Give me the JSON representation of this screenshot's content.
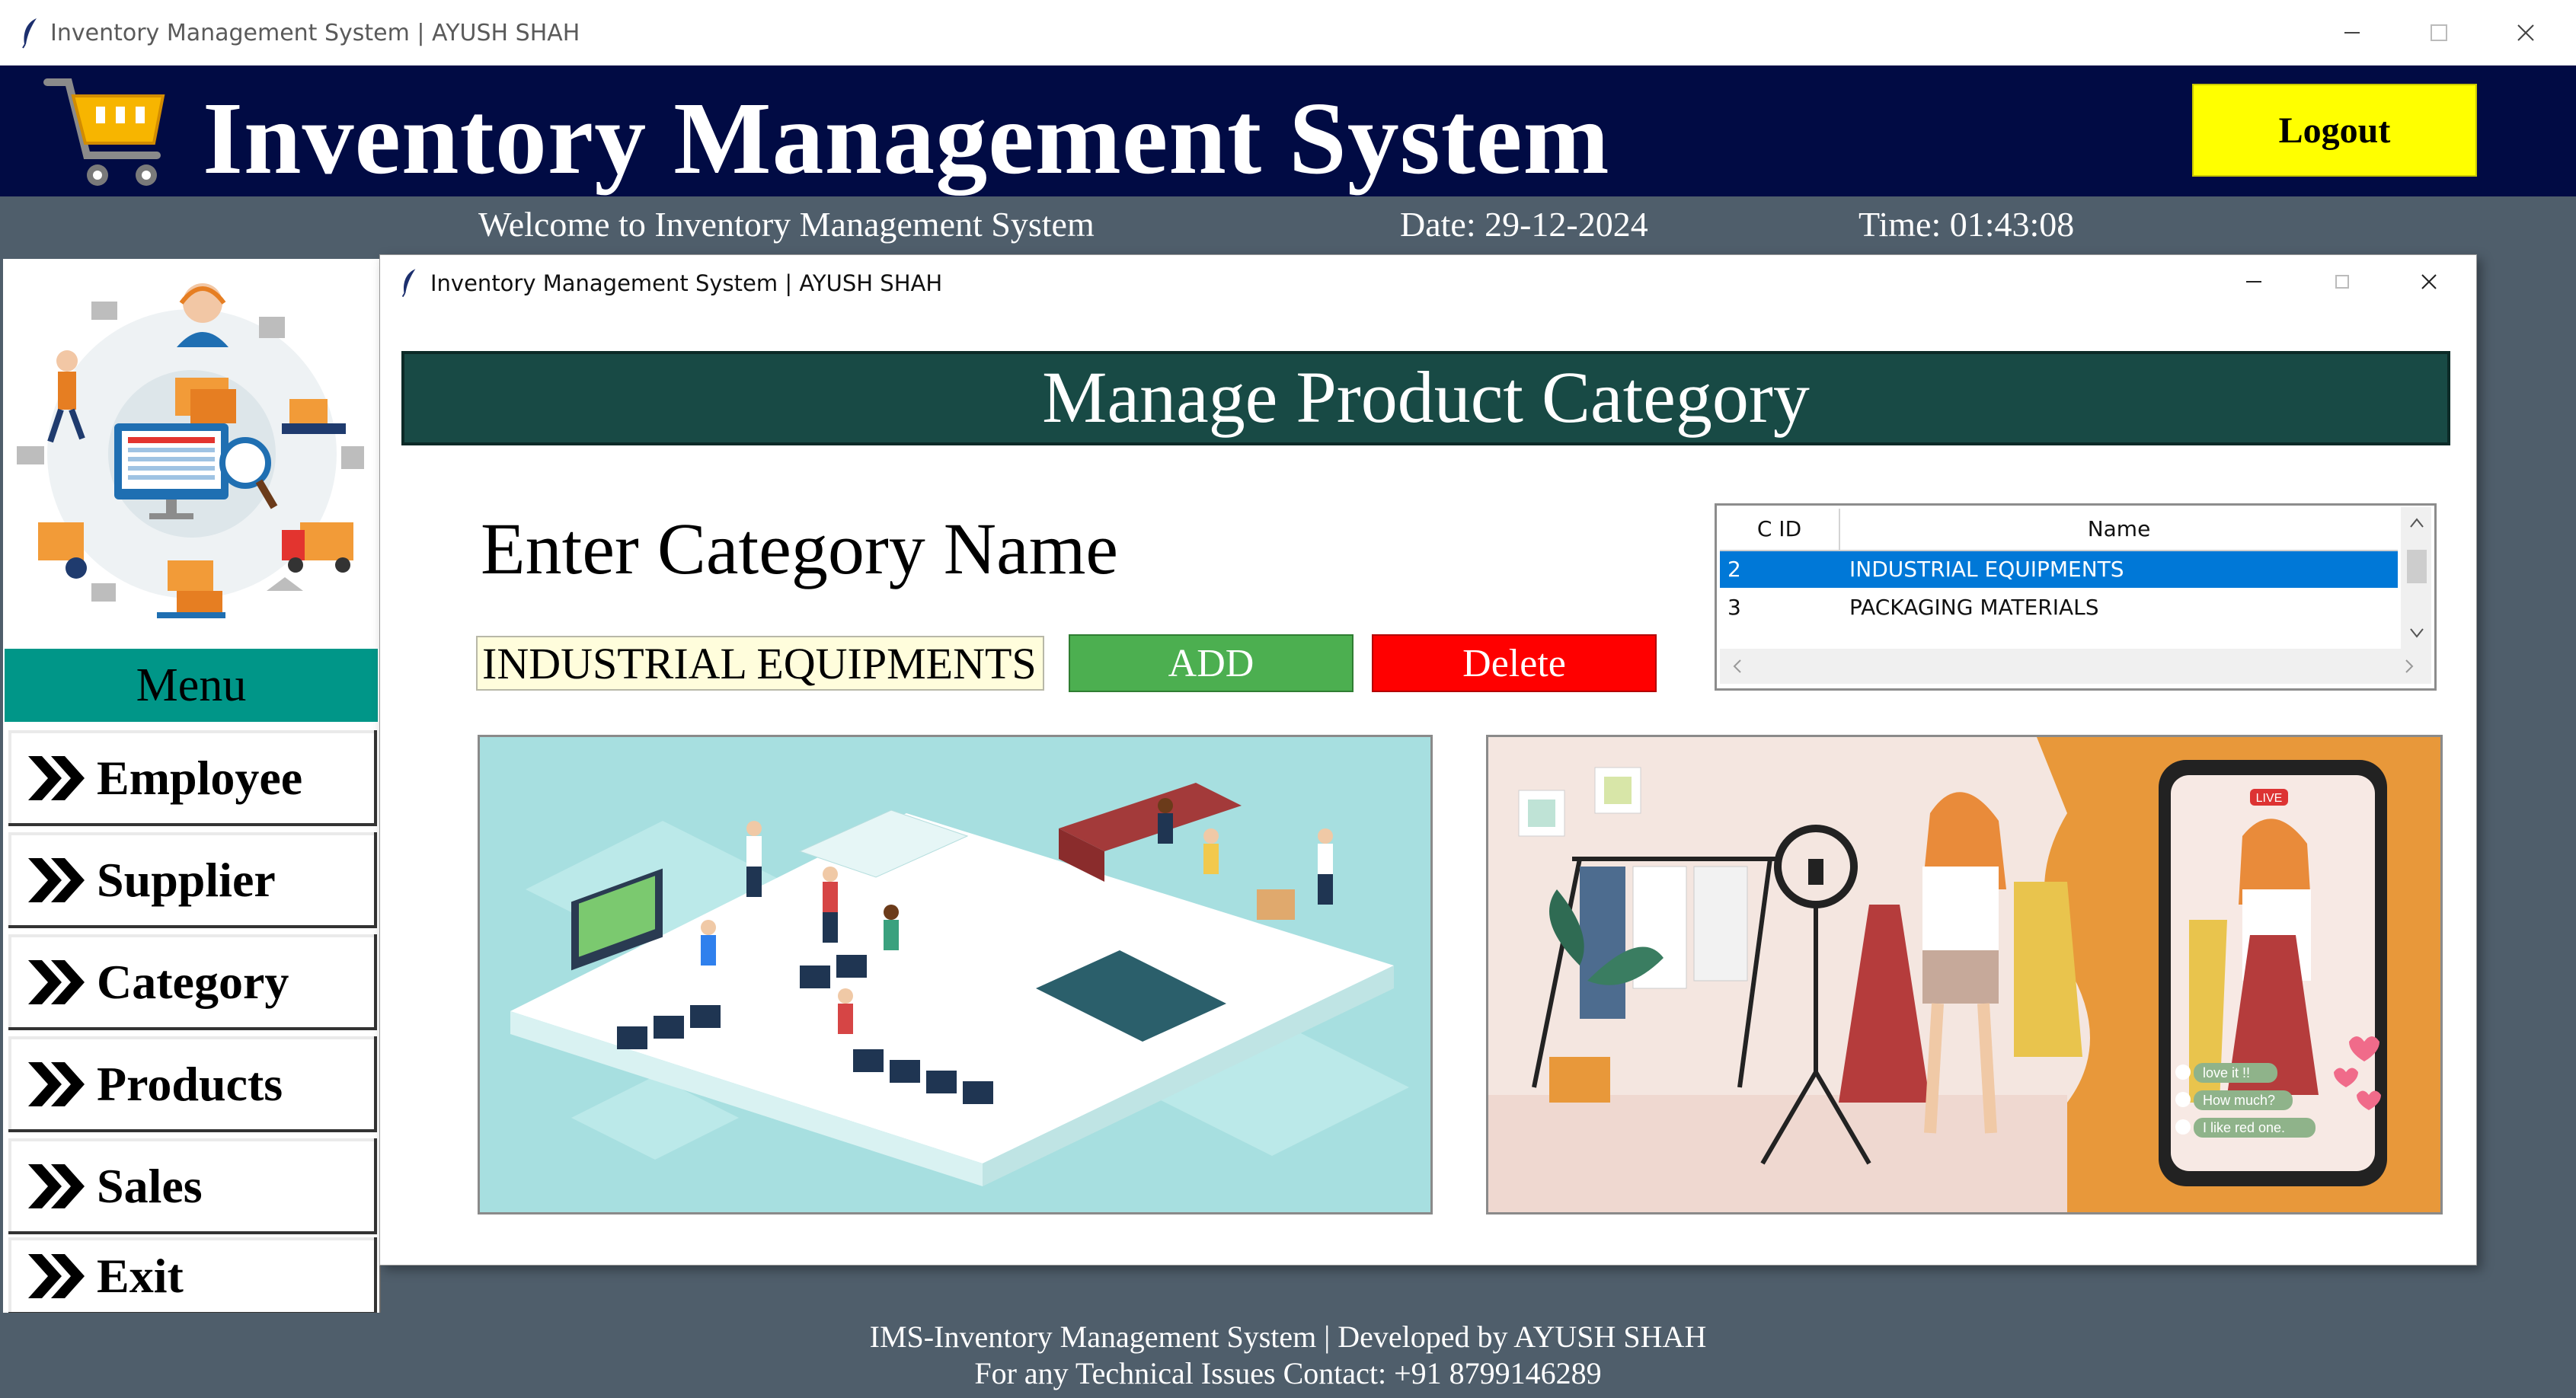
{
  "window": {
    "title": "Inventory Management System | AYUSH SHAH"
  },
  "header": {
    "title": "Inventory Management System",
    "logout_label": "Logout",
    "accent": "#010b44",
    "logout_color": "#ffff00"
  },
  "status_bar": {
    "welcome": "Welcome to Inventory Management System",
    "date": "Date: 29-12-2024",
    "time": "Time: 01:43:08"
  },
  "sidebar": {
    "menu_label": "Menu",
    "items": [
      {
        "label": "Employee",
        "icon": "double-chevron-right-icon"
      },
      {
        "label": "Supplier",
        "icon": "double-chevron-right-icon"
      },
      {
        "label": "Category",
        "icon": "double-chevron-right-icon"
      },
      {
        "label": "Products",
        "icon": "double-chevron-right-icon"
      },
      {
        "label": "Sales",
        "icon": "double-chevron-right-icon"
      },
      {
        "label": "Exit",
        "icon": "double-chevron-right-icon"
      }
    ]
  },
  "category_window": {
    "title": "Inventory Management System | AYUSH SHAH",
    "banner": "Manage Product Category",
    "field_label": "Enter Category Name",
    "category_input_value": "INDUSTRIAL EQUIPMENTS",
    "add_label": "ADD",
    "delete_label": "Delete",
    "table": {
      "columns": [
        "C ID",
        "Name"
      ],
      "rows": [
        {
          "cid": "2",
          "name": "INDUSTRIAL EQUIPMENTS",
          "selected": true
        },
        {
          "cid": "3",
          "name": "PACKAGING MATERIALS",
          "selected": false
        }
      ]
    },
    "live_chat": [
      "love it !!",
      "How much?",
      "I like red one."
    ],
    "live_badge": "LIVE"
  },
  "footer": {
    "line1": "IMS-Inventory Management System | Developed by AYUSH SHAH",
    "line2": "For any Technical Issues Contact: +91 8799146289"
  }
}
